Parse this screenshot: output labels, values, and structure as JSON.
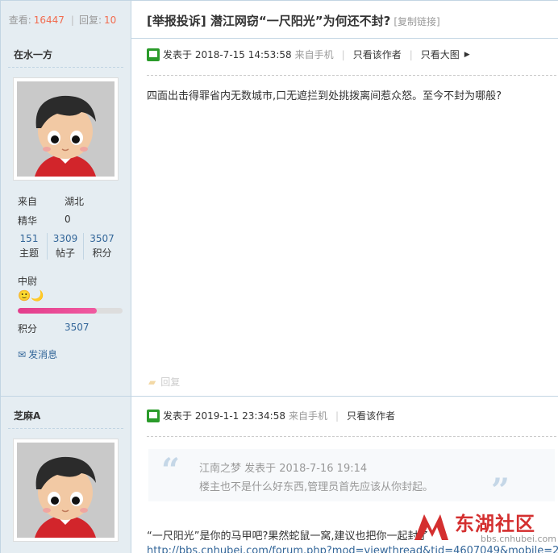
{
  "header": {
    "views_label": "查看:",
    "views_count": "16447",
    "replies_label": "回复:",
    "replies_count": "10",
    "title": "[举报投诉] 潜江网窃“一尺阳光”为何还不封?",
    "copy_link": "[复制链接]"
  },
  "posts": [
    {
      "author": "在水一方",
      "from_label": "来自",
      "from_value": "湖北",
      "digest_label": "精华",
      "digest_value": "0",
      "stats": [
        {
          "num": "151",
          "label": "主题"
        },
        {
          "num": "3309",
          "label": "帖子"
        },
        {
          "num": "3507",
          "label": "积分"
        }
      ],
      "rank": "中尉",
      "rank_icons": "🙂🌙",
      "level_progress_percent": 75,
      "points_label": "积分",
      "points_value": "3507",
      "pm_label": "发消息",
      "posted": "发表于 2018-7-15 14:53:58",
      "source": "来自手机",
      "only_author": "只看该作者",
      "only_big_image": "只看大图",
      "content": "四面出击得罪省内无数城市,口无遮拦到处挑拨离间惹众怒。至今不封为哪般?",
      "reply_label": "回复"
    },
    {
      "author": "芝麻A",
      "posted": "发表于 2019-1-1 23:34:58",
      "source": "来自手机",
      "only_author": "只看该作者",
      "quote_meta": "江南之梦 发表于 2018-7-16 19:14",
      "quote_text": "楼主也不是什么好东西,管理员首先应该从你封起。",
      "content_line1": "“一尺阳光”是你的马甲吧?果然蛇鼠一窝,建议也把你一起封了",
      "content_line2": "http://bbs.cnhubei.com/forum.php?mod=viewthread&tid=4607049&mobile=2"
    }
  ],
  "watermark": {
    "name": "东湖社区",
    "url": "bbs.cnhubei.com"
  },
  "colors": {
    "sidebar_bg": "#e5edf2",
    "border": "#c2d5e3",
    "link": "#336699",
    "highlight": "#f26c4f",
    "brand_red": "#d42f2f"
  }
}
